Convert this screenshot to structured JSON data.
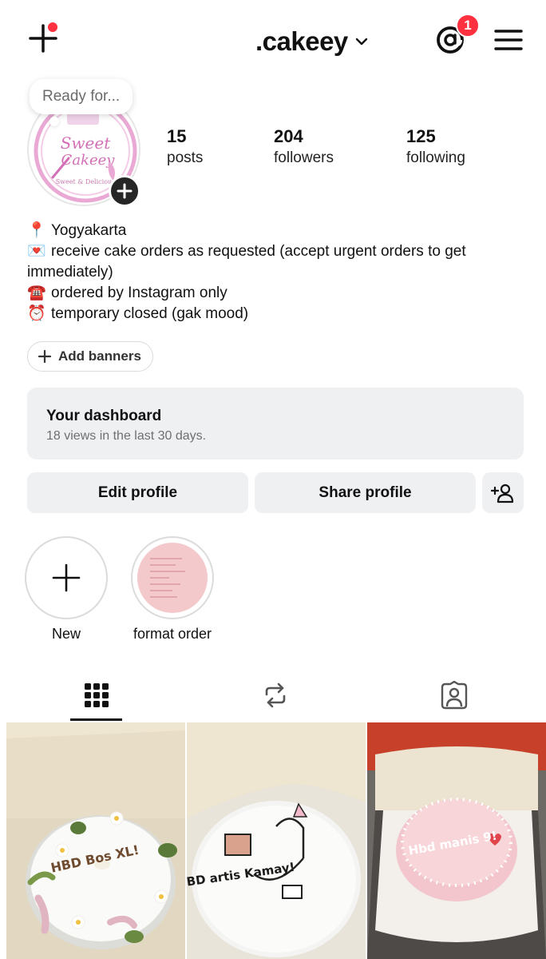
{
  "header": {
    "username": ".cakeey",
    "notification_count": "1"
  },
  "note": {
    "text": "Ready for..."
  },
  "avatar": {
    "logo_text": "Sweet Cakeey",
    "logo_tagline": "Sweet & Delicious"
  },
  "stats": [
    {
      "value": "15",
      "label": "posts"
    },
    {
      "value": "204",
      "label": "followers"
    },
    {
      "value": "125",
      "label": "following"
    }
  ],
  "bio": {
    "lines": [
      {
        "emoji": "📍",
        "text": "Yogyakarta"
      },
      {
        "emoji": "💌",
        "text": "receive cake orders as requested (accept urgent orders to get immediately)"
      },
      {
        "emoji": "☎️",
        "text": "ordered by Instagram only"
      },
      {
        "emoji": "⏰",
        "text": "temporary closed (gak mood)"
      }
    ]
  },
  "banner_button": {
    "label": "Add banners"
  },
  "dashboard": {
    "title": "Your dashboard",
    "subtitle": "18 views in the last 30 days."
  },
  "actions": {
    "edit_label": "Edit profile",
    "share_label": "Share profile"
  },
  "highlights": [
    {
      "label": "New"
    },
    {
      "label": "format order"
    }
  ],
  "tabs": [
    {
      "icon": "grid-icon",
      "active": true
    },
    {
      "icon": "reposts-icon",
      "active": false
    },
    {
      "icon": "tagged-icon",
      "active": false
    }
  ],
  "posts": [
    {
      "cake_text": "HBD Bos XL!"
    },
    {
      "cake_text": "HBD artis Kamay!"
    },
    {
      "cake_text": "Hbd manis 9!"
    }
  ],
  "colors": {
    "badge": "#ff3040",
    "button_bg": "#eff0f2",
    "cake_pink": "#f3c9cc"
  }
}
